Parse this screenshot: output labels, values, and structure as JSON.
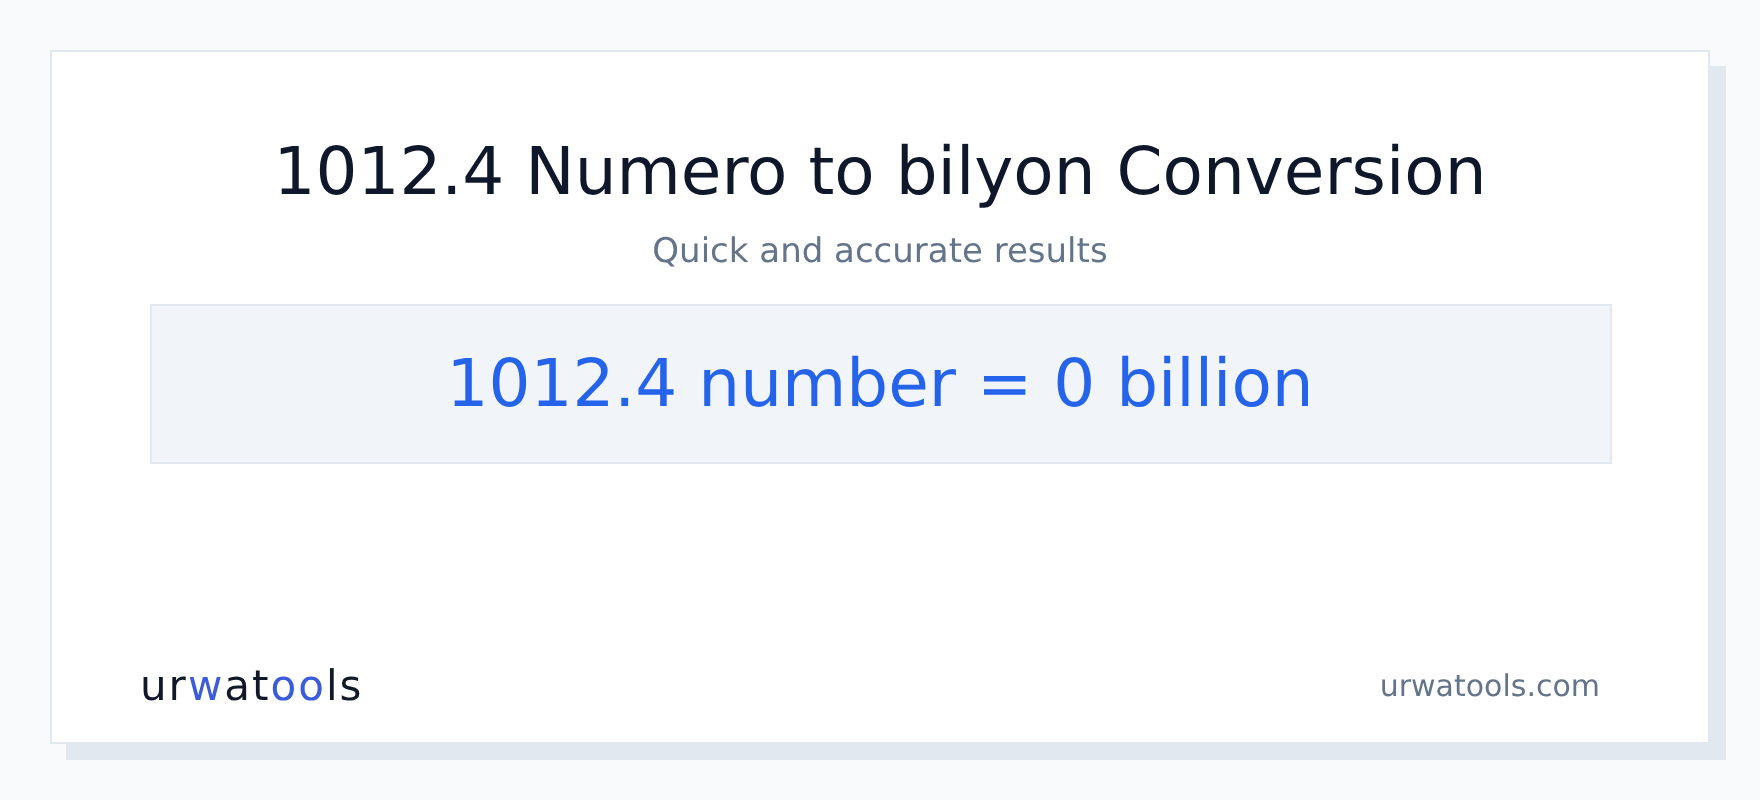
{
  "title": "1012.4 Numero to bilyon Conversion",
  "subtitle": "Quick and accurate results",
  "result": "1012.4 number = 0 billion",
  "logo": [
    {
      "text": "ur",
      "accent": false
    },
    {
      "text": "w",
      "accent": true
    },
    {
      "text": "at",
      "accent": false
    },
    {
      "text": "oo",
      "accent": true
    },
    {
      "text": "ls",
      "accent": false
    }
  ],
  "site": "urwatools.com"
}
